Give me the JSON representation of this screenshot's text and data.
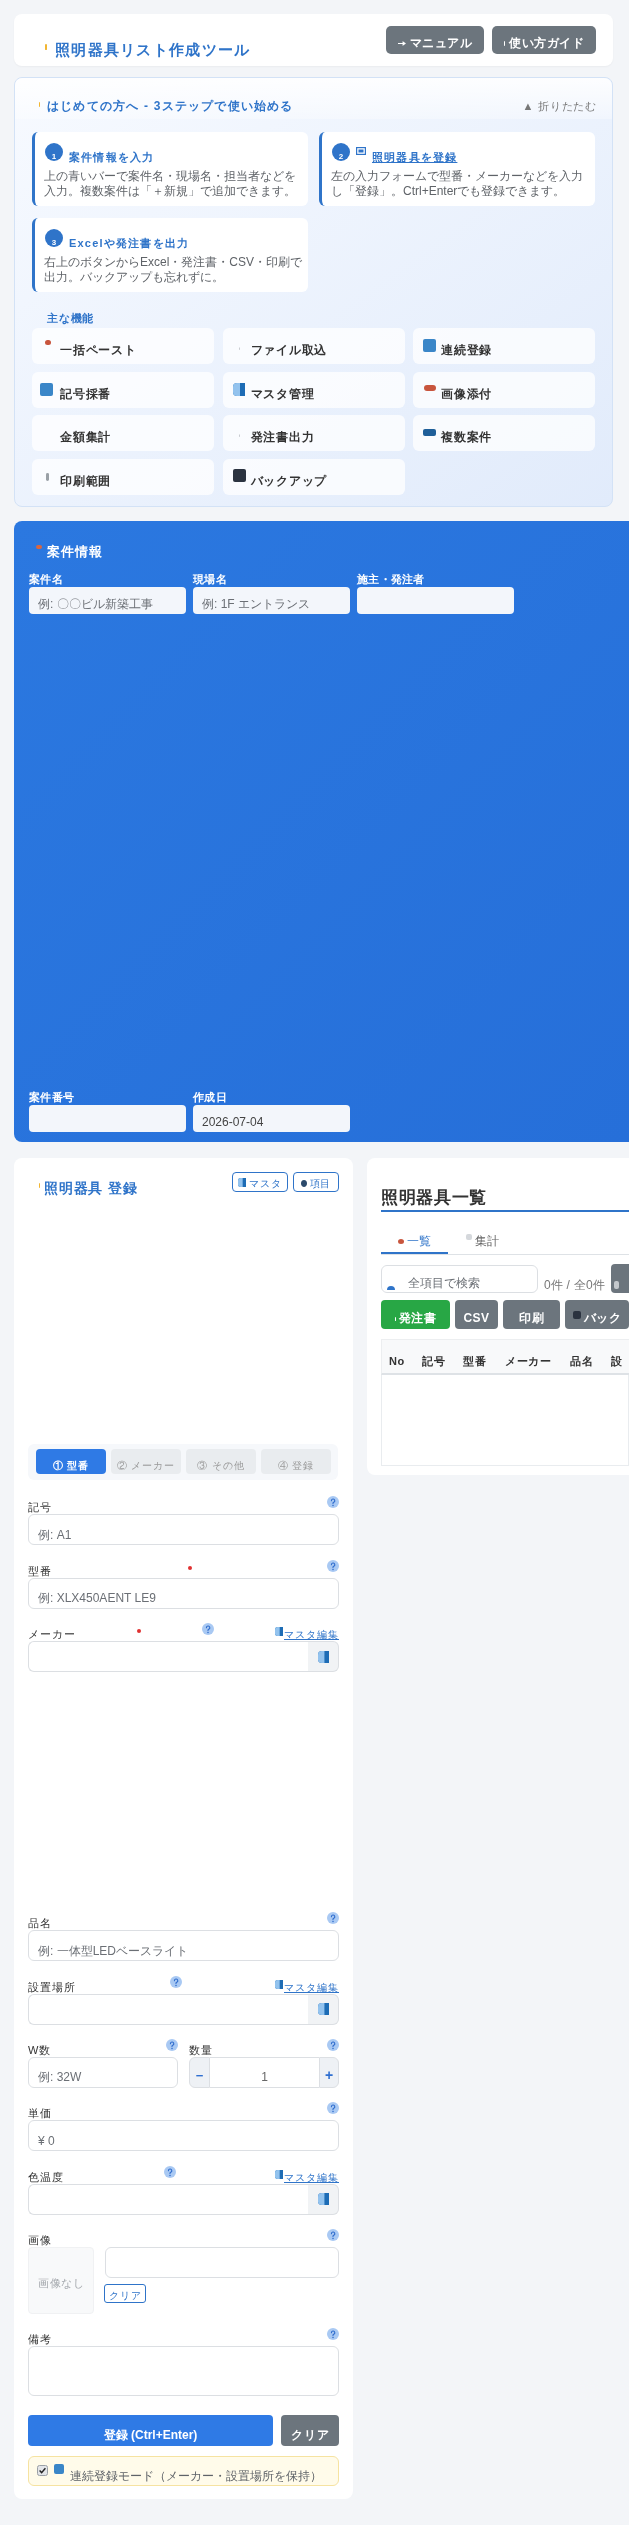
{
  "header": {
    "title": "照明器具リスト作成ツール",
    "buttons": [
      "マニュアル",
      "使い方ガイド"
    ]
  },
  "guide": {
    "title": "はじめての方へ - 3ステップで使い始める",
    "collapse": "▲ 折りたたむ",
    "steps": [
      {
        "number": "1",
        "title": "案件情報を入力",
        "underlined": false,
        "text": "上の青いバーで案件名・現場名・担当者などを入力。複数案件は「＋新規」で追加できます。"
      },
      {
        "number": "2",
        "title": "照明器具を登録",
        "underlined": true,
        "text": "左の入力フォームで型番・メーカーなどを入力し「登録」。Ctrl+Enterでも登録できます。"
      },
      {
        "number": "3",
        "title": "Excelや発注書を出力",
        "underlined": false,
        "text": "右上のボタンからExcel・発注書・CSV・印刷で出力。バックアップも忘れずに。"
      }
    ],
    "features_title": "主な機能",
    "features": [
      "一括ペースト",
      "ファイル取込",
      "連続登録",
      "記号採番",
      "マスタ管理",
      "画像添付",
      "金額集計",
      "発注書出力",
      "複数案件",
      "印刷範囲",
      "バックアップ"
    ]
  },
  "project": {
    "title": "案件情報",
    "fields": [
      {
        "label": "案件名",
        "placeholder": "例: 〇〇ビル新築工事"
      },
      {
        "label": "現場名",
        "placeholder": "例: 1F エントランス"
      },
      {
        "label": "施主・発注者"
      }
    ],
    "more_fields": [
      {
        "label": "案件番号"
      },
      {
        "label": "作成日",
        "value": "2026-07-04"
      }
    ]
  },
  "register": {
    "title": "照明器具 登録",
    "buttons": [
      "マスタ",
      "項目"
    ],
    "steps": [
      {
        "label": "① 型番",
        "selected": true
      },
      {
        "label": "② メーカー",
        "selected": false
      },
      {
        "label": "③ その他",
        "selected": false
      },
      {
        "label": "④ 登録",
        "selected": false
      }
    ],
    "fields": [
      {
        "kind": "text",
        "label": "記号",
        "placeholder": "例: A1",
        "required": false
      },
      {
        "kind": "text",
        "label": "型番",
        "placeholder": "例: XLX450AENT LE9",
        "required": true
      },
      {
        "kind": "select",
        "label": "メーカー",
        "required": true,
        "link": "マスタ編集"
      }
    ],
    "more_fields": [
      {
        "kind": "text",
        "label": "品名",
        "placeholder": "例: 一体型LEDベースライト",
        "required": false
      },
      {
        "kind": "select",
        "label": "設置場所",
        "required": false,
        "link": "マスタ編集"
      },
      {
        "kind": "pair",
        "items": [
          {
            "kind": "text",
            "label": "W数",
            "placeholder": "例: 32W",
            "required": false
          },
          {
            "kind": "stepper",
            "label": "数量",
            "value": "1",
            "minus": "−",
            "plus": "+"
          }
        ]
      },
      {
        "kind": "text",
        "label": "単価",
        "placeholder": "¥ 0",
        "required": false
      },
      {
        "kind": "select",
        "label": "色温度",
        "required": false,
        "link": "マスタ編集"
      },
      {
        "kind": "image",
        "label": "画像",
        "empty": "画像なし",
        "clear": "クリア"
      },
      {
        "kind": "textarea",
        "label": "備考"
      }
    ],
    "submit": "登録 (Ctrl+Enter)",
    "clear": "クリア",
    "continuous": {
      "label": "連続登録モード（メーカー・設置場所を保持）",
      "checked": true
    }
  },
  "list": {
    "title": "照明器具一覧",
    "tabs": [
      {
        "label": "一覧",
        "selected": true
      },
      {
        "label": "集計",
        "selected": false
      }
    ],
    "search": {
      "placeholder": "全項目で検索"
    },
    "count": "0件 / 全0件",
    "buttons": [
      {
        "label": "発注書",
        "color": "#28a745"
      },
      {
        "label": "CSV",
        "color": "#6c757d"
      },
      {
        "label": "印刷",
        "color": "#6c757d"
      },
      {
        "label": "バック",
        "color": "#6c757d"
      }
    ],
    "columns": [
      "No",
      "記号",
      "型番",
      "メーカー",
      "品名",
      "設"
    ]
  }
}
